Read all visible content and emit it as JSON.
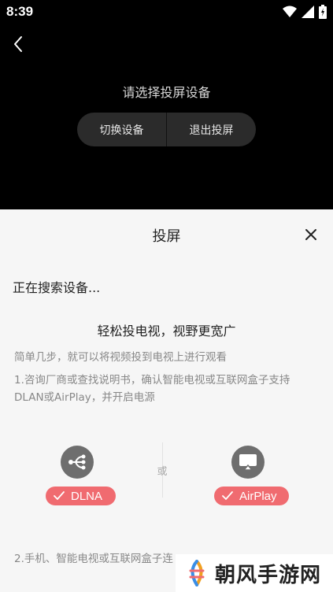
{
  "status_bar": {
    "time": "8:39",
    "icons": [
      "wifi-icon",
      "signal-icon",
      "battery-icon"
    ]
  },
  "player": {
    "prompt": "请选择投屏设备",
    "switch_device": "切换设备",
    "exit_cast": "退出投屏"
  },
  "sheet": {
    "title": "投屏",
    "searching": "正在搜索设备...",
    "tagline": "轻松投电视，视野更宽广",
    "hint": "简单几步，就可以将视频投到电视上进行观看",
    "step1": "1.咨询厂商或查找说明书，确认智能电视或互联网盒子支持DLAN或AirPlay，并开启电源",
    "or": "或",
    "dlna_label": "DLNA",
    "airplay_label": "AirPlay",
    "step2": "2.手机、智能电视或互联网盒子连"
  },
  "watermark": {
    "text": "朝风手游网"
  },
  "colors": {
    "accent": "#f06b70",
    "dark_bg": "#000000",
    "sheet_bg": "#f6f6f6",
    "icon_gray": "#6e6e6e"
  }
}
